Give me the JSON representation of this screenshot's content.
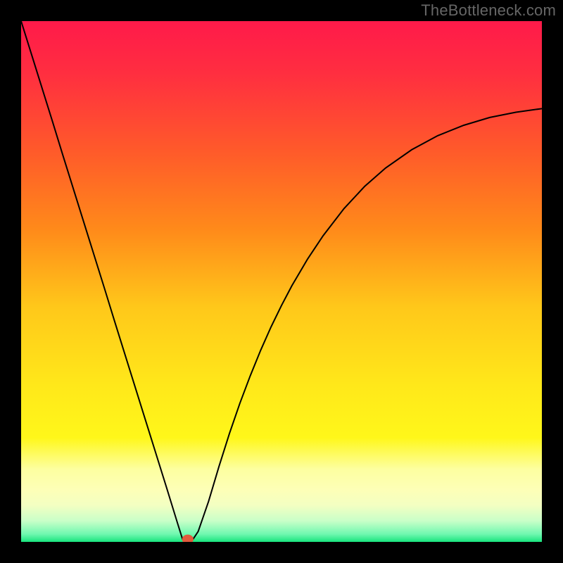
{
  "watermark": "TheBottleneck.com",
  "chart_data": {
    "type": "line",
    "title": "",
    "xlabel": "",
    "ylabel": "",
    "xlim": [
      0,
      100
    ],
    "ylim": [
      0,
      100
    ],
    "background_gradient": {
      "stops": [
        {
          "offset": 0.0,
          "color": "#ff1a4a"
        },
        {
          "offset": 0.1,
          "color": "#ff2e40"
        },
        {
          "offset": 0.25,
          "color": "#ff5a2a"
        },
        {
          "offset": 0.4,
          "color": "#ff8a1a"
        },
        {
          "offset": 0.55,
          "color": "#ffc81a"
        },
        {
          "offset": 0.7,
          "color": "#ffe81a"
        },
        {
          "offset": 0.8,
          "color": "#fff71a"
        },
        {
          "offset": 0.86,
          "color": "#fdffa0"
        },
        {
          "offset": 0.9,
          "color": "#fdffb7"
        },
        {
          "offset": 0.93,
          "color": "#f3ffc2"
        },
        {
          "offset": 0.96,
          "color": "#c8ffc8"
        },
        {
          "offset": 0.985,
          "color": "#70f8b0"
        },
        {
          "offset": 1.0,
          "color": "#18e47e"
        }
      ]
    },
    "series": [
      {
        "name": "curve",
        "color": "#000000",
        "stroke_width": 2,
        "x": [
          0,
          2,
          4,
          6,
          8,
          10,
          12,
          14,
          16,
          18,
          20,
          22,
          24,
          26,
          28,
          30,
          31,
          32,
          33,
          34,
          36,
          38,
          40,
          42,
          44,
          46,
          48,
          50,
          52,
          55,
          58,
          62,
          66,
          70,
          75,
          80,
          85,
          90,
          95,
          100
        ],
        "y": [
          100,
          93.6,
          87.2,
          80.8,
          74.3,
          67.9,
          61.5,
          55.1,
          48.7,
          42.2,
          35.8,
          29.4,
          23.0,
          16.6,
          10.2,
          3.7,
          0.5,
          0.5,
          0.5,
          2.0,
          7.8,
          14.5,
          20.8,
          26.6,
          31.9,
          36.8,
          41.3,
          45.4,
          49.2,
          54.3,
          58.8,
          64.0,
          68.3,
          71.8,
          75.3,
          78.0,
          80.0,
          81.5,
          82.5,
          83.2
        ]
      }
    ],
    "marker": {
      "x": 32,
      "y": 0.5,
      "rx": 1.1,
      "ry": 0.9,
      "color": "#e2593c"
    }
  }
}
